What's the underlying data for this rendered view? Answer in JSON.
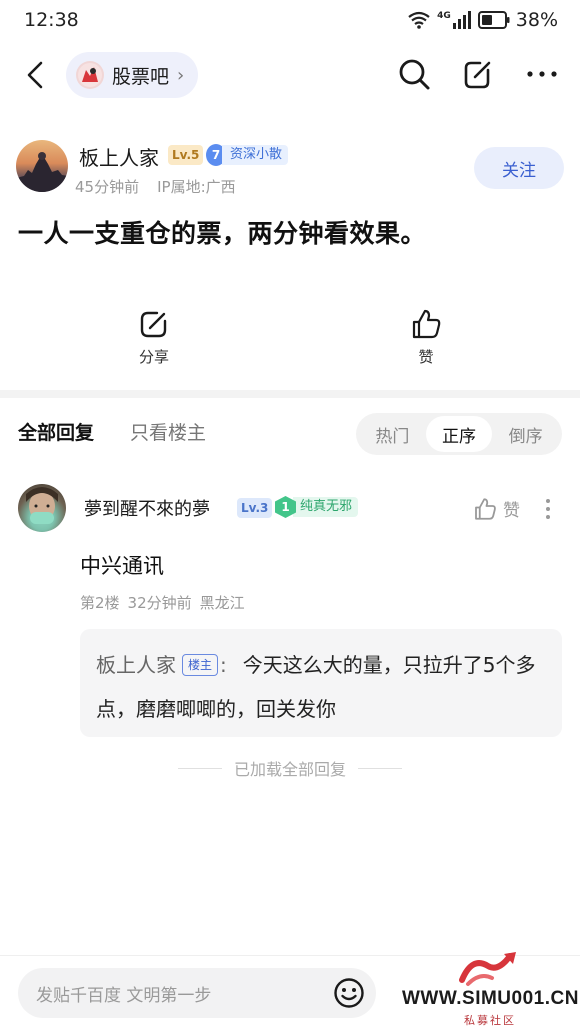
{
  "status_bar": {
    "time": "12:38",
    "network": "4G",
    "battery": "38%"
  },
  "nav": {
    "forum_name": "股票吧",
    "forum_arrow": "›"
  },
  "post": {
    "author": {
      "name": "板上人家",
      "level": "Lv.5",
      "title_badge_number": "7",
      "title_badge_text": "资深小散",
      "time_ago": "45分钟前",
      "ip_location": "IP属地:广西",
      "follow_label": "关注"
    },
    "title": "一人一支重仓的票，两分钟看效果。",
    "actions": {
      "share_label": "分享",
      "like_label": "赞"
    }
  },
  "replies_header": {
    "tab_all": "全部回复",
    "tab_op_only": "只看楼主",
    "sort_options": [
      "热门",
      "正序",
      "倒序"
    ],
    "sort_selected": "正序"
  },
  "comments": [
    {
      "name": "夢到醒不來的夢",
      "level": "Lv.3",
      "title_badge_number": "1",
      "title_badge_text": "纯真无邪",
      "like_label": "赞",
      "body": "中兴通讯",
      "floor": "第2楼",
      "time_ago": "32分钟前",
      "location": "黑龙江",
      "sub_reply": {
        "name": "板上人家",
        "op_tag": "楼主",
        "separator": ":",
        "text": "今天这么大的量，只拉升了5个多点，磨磨唧唧的，回关发你"
      }
    }
  ],
  "all_loaded_text": "已加载全部回复",
  "bottom_bar": {
    "input_placeholder": "发贴千百度 文明第一步"
  },
  "watermark": {
    "url": "WWW.SIMU001.CN",
    "subtitle": "私募社区"
  },
  "colors": {
    "accent_blue": "#3a5fd0",
    "follow_bg": "#e9eefc",
    "green_badge": "#43c58a",
    "watermark_red": "#d7353b"
  }
}
